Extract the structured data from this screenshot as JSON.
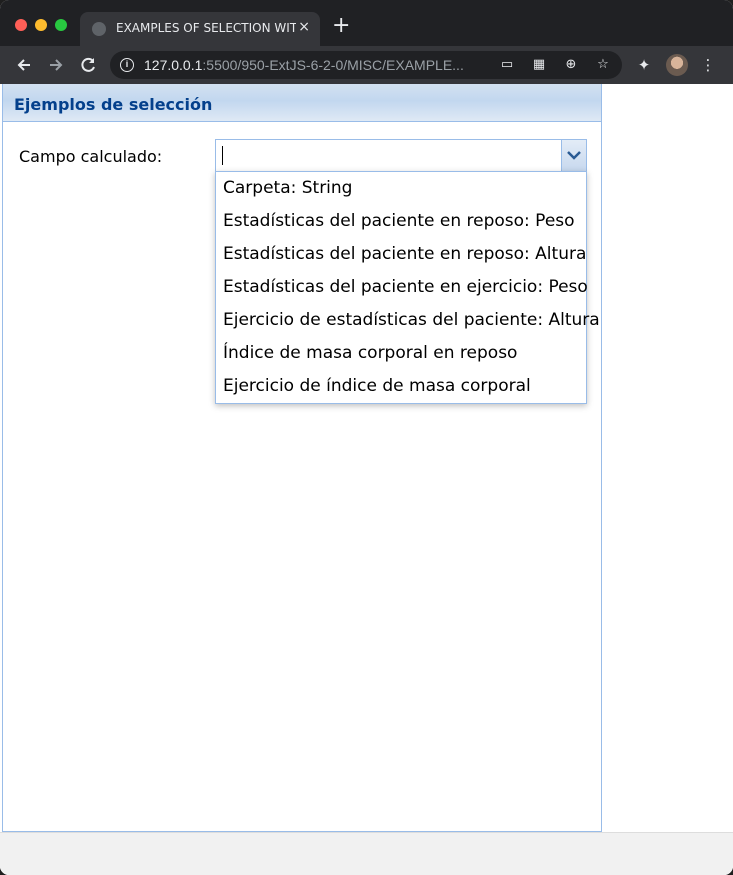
{
  "browser": {
    "tab_title": "EXAMPLES OF SELECTION WITH",
    "tab_close": "×",
    "new_tab": "+",
    "url_host": "127.0.0.1",
    "url_rest": ":5500/950-ExtJS-6-2-0/MISC/EXAMPLE...",
    "icons": [
      "back-icon",
      "forward-icon",
      "reload-icon",
      "info-icon",
      "cast-icon",
      "qr-icon",
      "zoom-icon",
      "star-icon",
      "extensions-icon",
      "menu-icon"
    ]
  },
  "panel": {
    "title": "Ejemplos de selección"
  },
  "field": {
    "label": "Campo calculado:",
    "value": ""
  },
  "dropdown": {
    "options": [
      "Carpeta: String",
      "Estadísticas del paciente en reposo: Peso",
      "Estadísticas del paciente en reposo: Altura",
      "Estadísticas del paciente en ejercicio: Peso",
      "Ejercicio de estadísticas del paciente: Altura",
      "Índice de masa corporal en reposo",
      "Ejercicio de índice de masa corporal"
    ]
  },
  "colors": {
    "panel_title": "#04408c",
    "border": "#99bce8",
    "chrome_dark": "#202124"
  }
}
